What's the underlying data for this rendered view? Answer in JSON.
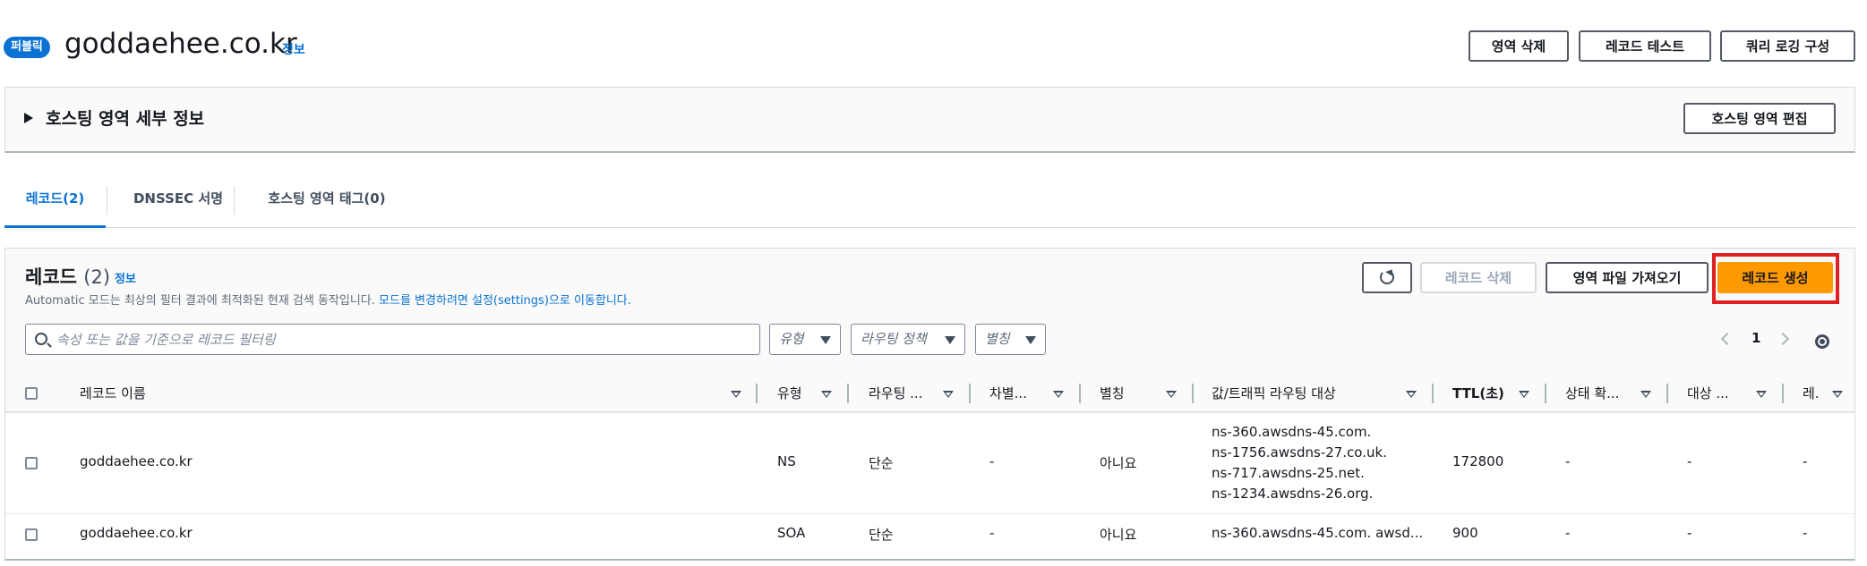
{
  "header": {
    "badge": "퍼블릭",
    "title": "goddaehee.co.kr",
    "info": "정보",
    "buttons": [
      "영역 삭제",
      "레코드 테스트",
      "쿼리 로깅 구성"
    ]
  },
  "details_panel": {
    "title": "호스팅 영역 세부 정보",
    "edit_button": "호스팅 영역 편집"
  },
  "tabs": [
    "레코드(2)",
    "DNSSEC 서명",
    "호스팅 영역 태그(0)"
  ],
  "records": {
    "title": "레코드",
    "count": "(2)",
    "info": "정보",
    "description": "Automatic 모드는 최상의 필터 결과에 최적화된 현재 검색 동작입니다.",
    "description_link": "모드를 변경하려면 설정(settings)으로 이동합니다.",
    "buttons": {
      "delete": "레코드 삭제",
      "import": "영역 파일 가져오기",
      "create": "레코드 생성"
    },
    "search_placeholder": "속성 또는 값을 기준으로 레코드 필터링",
    "filters": [
      "유형",
      "라우팅 정책",
      "별칭"
    ],
    "page": "1",
    "columns": [
      "레코드 이름",
      "유형",
      "라우팅 ...",
      "차별...",
      "별칭",
      "값/트래픽 라우팅 대상",
      "TTL(초)",
      "상태 확...",
      "대상 ...",
      "레."
    ],
    "rows": [
      {
        "name": "goddaehee.co.kr",
        "type": "NS",
        "routing": "단순",
        "diff": "-",
        "alias": "아니요",
        "value": [
          "ns-360.awsdns-45.com.",
          "ns-1756.awsdns-27.co.uk.",
          "ns-717.awsdns-25.net.",
          "ns-1234.awsdns-26.org."
        ],
        "ttl": "172800",
        "health": "-",
        "target": "-",
        "rec": "-"
      },
      {
        "name": "goddaehee.co.kr",
        "type": "SOA",
        "routing": "단순",
        "diff": "-",
        "alias": "아니요",
        "value": [
          "ns-360.awsdns-45.com. awsd..."
        ],
        "ttl": "900",
        "health": "-",
        "target": "-",
        "rec": "-"
      }
    ]
  },
  "colors": {
    "primary": "#ff9900",
    "link": "#0972d3",
    "highlight": "#e02020"
  }
}
